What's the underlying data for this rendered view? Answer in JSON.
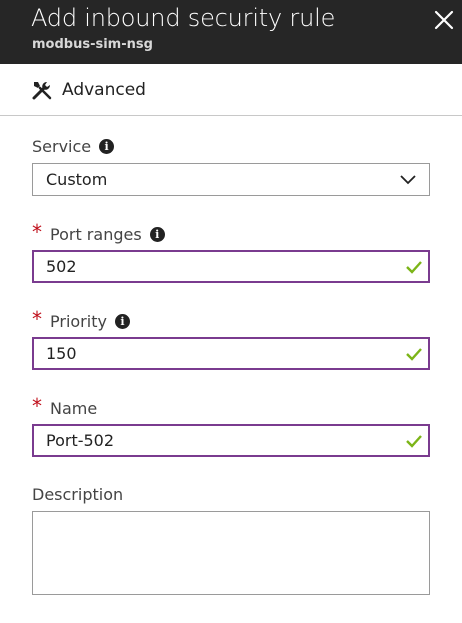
{
  "header": {
    "title": "Add inbound security rule",
    "subtitle": "modbus-sim-nsg"
  },
  "toolbar": {
    "advanced_label": "Advanced"
  },
  "form": {
    "service": {
      "label": "Service",
      "value": "Custom"
    },
    "port_ranges": {
      "label": "Port ranges",
      "value": "502",
      "required": true
    },
    "priority": {
      "label": "Priority",
      "value": "150",
      "required": true
    },
    "name": {
      "label": "Name",
      "value": "Port-502",
      "required": true
    },
    "description": {
      "label": "Description",
      "value": ""
    },
    "required_marker": "*",
    "info_glyph": "i"
  },
  "icons": {
    "close": "close-icon",
    "advanced": "tools-icon",
    "info": "info-icon",
    "dropdown": "chevron-down-icon",
    "valid": "checkmark-icon"
  },
  "colors": {
    "header_bg": "#262626",
    "input_border": "#7a3b8f",
    "valid_check": "#7cb518",
    "required": "#c0101c"
  }
}
